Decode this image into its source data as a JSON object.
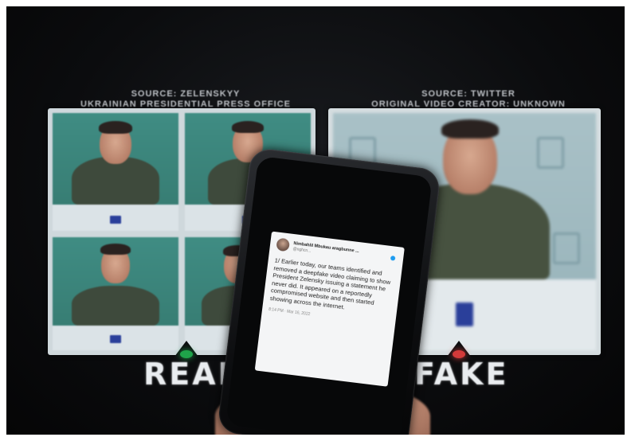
{
  "scene": {
    "left_caption": {
      "line1": "SOURCE: ZELENSKYY",
      "line2": "UKRAINIAN PRESIDENTIAL PRESS OFFICE"
    },
    "right_caption": {
      "line1": "SOURCE: TWITTER",
      "line2": "ORIGINAL VIDEO CREATOR: UNKNOWN"
    },
    "left_label": "REAL",
    "right_label": "FAKE",
    "colors": {
      "background": "#0b0c0e",
      "real_indicator": "#1fa34a",
      "fake_indicator": "#d43a3a",
      "label": "#e9ecef",
      "tile_backdrop": "#3f8c83",
      "shirt": "#3e4a3c"
    }
  },
  "phone": {
    "tweet": {
      "author": "Nimbahlil Mbukau aragbunne ...",
      "handle": "@nghcn...",
      "body": "1/ Earlier today, our teams identified and removed a deepfake video claiming to show President Zelensky issuing a statement he never did. It appeared on a reportedly compromised website and then started showing across the internet.",
      "timestamp": "8:14 PM · Mar 16, 2022"
    }
  }
}
